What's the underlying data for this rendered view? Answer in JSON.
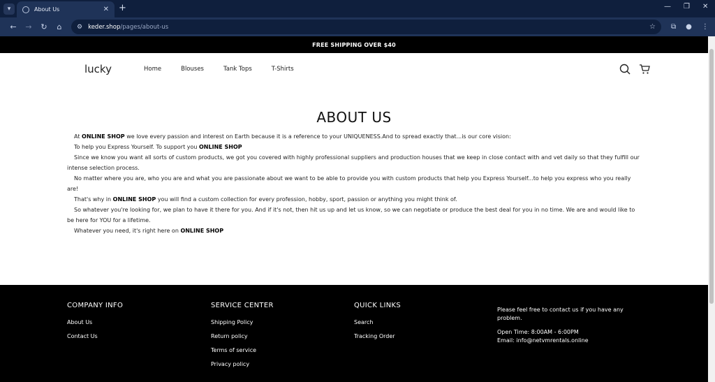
{
  "browser": {
    "tab_title": "About Us",
    "url_host": "keder.shop",
    "url_path": "/pages/about-us"
  },
  "announcement": "FREE SHIPPING OVER $40",
  "header": {
    "logo": "lucky",
    "nav": [
      "Home",
      "Blouses",
      "Tank Tops",
      "T-Shirts"
    ]
  },
  "page": {
    "title": "ABOUT US",
    "paragraphs": [
      {
        "pre": "At ",
        "bold": "ONLINE SHOP",
        "post": " we love every passion and interest on Earth because it is a reference to your UNIQUENESS.And to spread exactly that...is our core vision:"
      },
      {
        "pre": "To help you Express Yourself. To support you ",
        "bold": "ONLINE SHOP",
        "post": ""
      },
      {
        "pre": "Since we know you want all sorts of custom products, we got you covered with highly professional suppliers and production houses that we keep in close contact with and vet daily so that they fulfill our intense selection process.",
        "bold": "",
        "post": ""
      },
      {
        "pre": "No matter where you are, who you are and what you are passionate about we want to be able to provide you with custom products that help you Express Yourself...to help you express who you really are!",
        "bold": "",
        "post": ""
      },
      {
        "pre": "That's why in ",
        "bold": "ONLINE SHOP",
        "post": " you will find a custom collection for every profession, hobby, sport, passion or anything you might think of."
      },
      {
        "pre": "So whatever you're looking for, we plan to have it there for you. And if it's not, then hit us up and let us know, so we can negotiate or produce the best deal for you in no time. We are and would like to be here for YOU for a lifetime.",
        "bold": "",
        "post": ""
      },
      {
        "pre": "Whatever you need, it's right here on ",
        "bold": "ONLINE SHOP",
        "post": ""
      }
    ]
  },
  "footer": {
    "company": {
      "title": "COMPANY INFO",
      "links": [
        "About Us",
        "Contact Us"
      ]
    },
    "service": {
      "title": "SERVICE CENTER",
      "links": [
        "Shipping Policy",
        "Return policy",
        "Terms of service",
        "Privacy policy"
      ]
    },
    "quick": {
      "title": "QUICK LINKS",
      "links": [
        "Search",
        "Tracking Order"
      ]
    },
    "contact": {
      "intro": "Please feel free to contact us if you have any problem.",
      "hours": "Open Time: 8:00AM - 6:00PM",
      "email": "Email: info@netvmrentals.online"
    }
  }
}
